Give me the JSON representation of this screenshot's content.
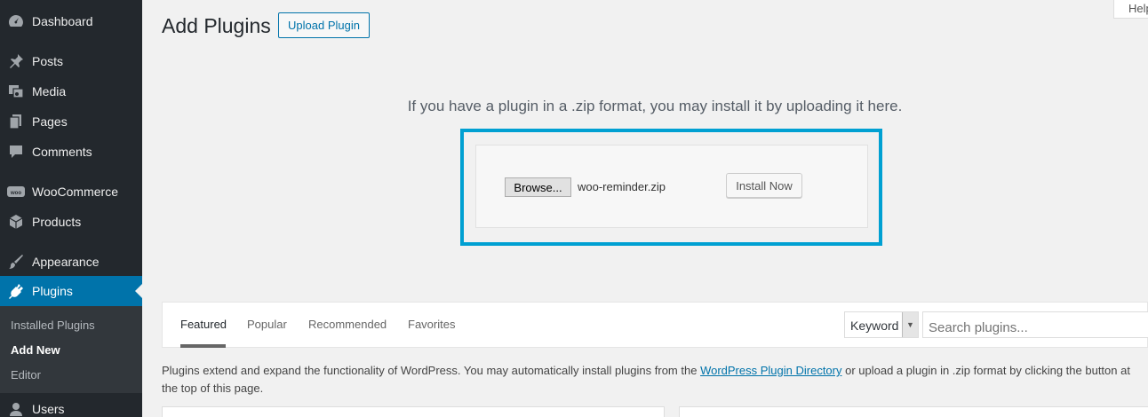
{
  "sidebar": {
    "items": [
      {
        "label": "Dashboard",
        "icon": "dashboard-icon"
      },
      {
        "label": "Posts",
        "icon": "pin-icon"
      },
      {
        "label": "Media",
        "icon": "media-icon"
      },
      {
        "label": "Pages",
        "icon": "pages-icon"
      },
      {
        "label": "Comments",
        "icon": "comment-icon"
      },
      {
        "label": "WooCommerce",
        "icon": "woo-icon"
      },
      {
        "label": "Products",
        "icon": "box-icon"
      },
      {
        "label": "Appearance",
        "icon": "brush-icon"
      },
      {
        "label": "Plugins",
        "icon": "plugin-icon"
      },
      {
        "label": "Users",
        "icon": "user-icon"
      }
    ],
    "submenu": [
      "Installed Plugins",
      "Add New",
      "Editor"
    ]
  },
  "header": {
    "title": "Add Plugins",
    "upload_label": "Upload Plugin",
    "help_label": "Help"
  },
  "upload": {
    "info": "If you have a plugin in a .zip format, you may install it by uploading it here.",
    "browse_label": "Browse...",
    "file_name": "woo-reminder.zip",
    "install_label": "Install Now"
  },
  "filter": {
    "tabs": [
      "Featured",
      "Popular",
      "Recommended",
      "Favorites"
    ],
    "keyword": "Keyword",
    "search_placeholder": "Search plugins..."
  },
  "description": {
    "before": "Plugins extend and expand the functionality of WordPress. You may automatically install plugins from the ",
    "link": "WordPress Plugin Directory",
    "after": " or upload a plugin in .zip format by clicking the button at the top of this page."
  },
  "colors": {
    "sidebar_bg": "#23282d",
    "active": "#0073aa",
    "highlight": "#00a0d2"
  }
}
